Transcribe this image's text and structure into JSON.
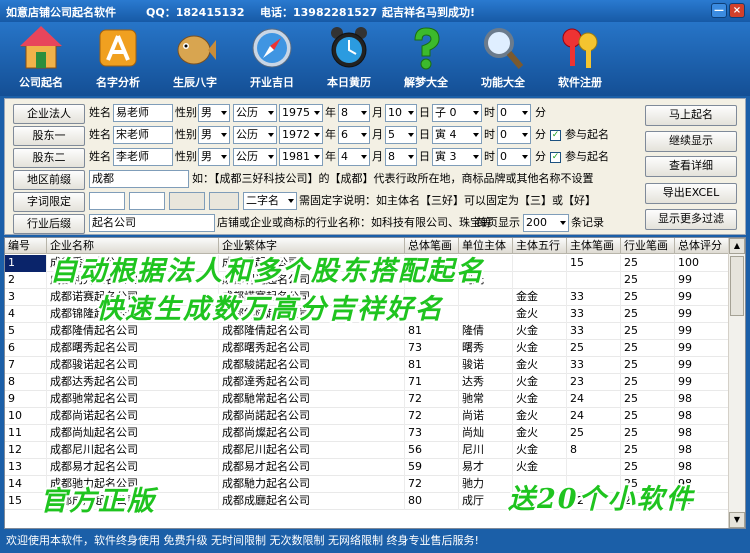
{
  "window": {
    "title": "如意店铺公司起名软件",
    "qq": "QQ：182415132",
    "phone": "电话：13982281527",
    "slogan": "起吉祥名马到成功!",
    "min": "—",
    "close": "×"
  },
  "toolbar": [
    {
      "label": "公司起名",
      "icon": "house-icon"
    },
    {
      "label": "名字分析",
      "icon": "tools-icon"
    },
    {
      "label": "生辰八字",
      "icon": "fish-icon"
    },
    {
      "label": "开业吉日",
      "icon": "compass-icon"
    },
    {
      "label": "本日黄历",
      "icon": "alarm-clock-icon"
    },
    {
      "label": "解梦大全",
      "icon": "question-icon"
    },
    {
      "label": "功能大全",
      "icon": "magnifier-icon"
    },
    {
      "label": "软件注册",
      "icon": "keys-icon"
    }
  ],
  "form": {
    "persons": [
      {
        "role": "企业法人",
        "name_label": "姓名",
        "name": "易老师",
        "sex_label": "性别",
        "sex": "男",
        "cal": "公历",
        "year": "1975",
        "year_u": "年",
        "month": "8",
        "month_u": "月",
        "day": "10",
        "day_u": "日",
        "hour_gz": "子 0",
        "hour_u": "时",
        "minute": "0",
        "minute_u": "分",
        "check": "",
        "check_label": ""
      },
      {
        "role": "股东一",
        "name_label": "姓名",
        "name": "宋老师",
        "sex_label": "性别",
        "sex": "男",
        "cal": "公历",
        "year": "1972",
        "year_u": "年",
        "month": "6",
        "month_u": "月",
        "day": "5",
        "day_u": "日",
        "hour_gz": "寅 4",
        "hour_u": "时",
        "minute": "0",
        "minute_u": "分",
        "check": "✓",
        "check_label": "参与起名"
      },
      {
        "role": "股东二",
        "name_label": "姓名",
        "name": "李老师",
        "sex_label": "性别",
        "sex": "男",
        "cal": "公历",
        "year": "1981",
        "year_u": "年",
        "month": "4",
        "month_u": "月",
        "day": "8",
        "day_u": "日",
        "hour_gz": "寅 3",
        "hour_u": "时",
        "minute": "0",
        "minute_u": "分",
        "check": "✓",
        "check_label": "参与起名"
      }
    ],
    "region_btn": "地区前缀",
    "region_value": "成都",
    "region_hint": "如：【成都三好科技公司】的【成都】代表行政所在地，商标品牌或其他名称不设置",
    "word_btn": "字词限定",
    "word_select": "二字名",
    "word_hint": "需固定字说明：如主体名【三好】可以固定为【三】或【好】",
    "industry_btn": "行业后缀",
    "industry_value": "起名公司",
    "industry_hint": "店铺或企业或商标的行业名称：如科技有限公司、珠宝等",
    "per_page_label": "每页显示",
    "per_page": "200",
    "per_page_unit": "条记录",
    "right_buttons": [
      "马上起名",
      "继续显示",
      "查看详细",
      "导出EXCEL",
      "显示更多过滤"
    ]
  },
  "table": {
    "headers": [
      "编号",
      "企业名称",
      "企业繁体字",
      "总体笔画",
      "单位主体",
      "主体五行",
      "主体笔画",
      "行业笔画",
      "总体评分"
    ],
    "rows": [
      [
        "1",
        "成都秀起名公司",
        "成都秀起名公司",
        "",
        "",
        "",
        "15",
        "25",
        "100"
      ],
      [
        "2",
        "成都利光起名公司",
        "成都利光起名公司",
        "",
        "利光",
        "",
        "",
        "25",
        "99"
      ],
      [
        "3",
        "成都诺赛起名公司",
        "成都諾賽起名公司",
        "",
        "",
        "金金",
        "33",
        "25",
        "99"
      ],
      [
        "4",
        "成都锦隆起名公司",
        "成都錦隆起名公司",
        "",
        "",
        "金火",
        "33",
        "25",
        "99"
      ],
      [
        "5",
        "成都隆倩起名公司",
        "成都隆倩起名公司",
        "81",
        "隆倩",
        "火金",
        "33",
        "25",
        "99"
      ],
      [
        "6",
        "成都曙秀起名公司",
        "成都曙秀起名公司",
        "73",
        "曙秀",
        "火金",
        "25",
        "25",
        "99"
      ],
      [
        "7",
        "成都骏诺起名公司",
        "成都駿諾起名公司",
        "81",
        "骏诺",
        "金火",
        "33",
        "25",
        "99"
      ],
      [
        "8",
        "成都达秀起名公司",
        "成都達秀起名公司",
        "71",
        "达秀",
        "火金",
        "23",
        "25",
        "99"
      ],
      [
        "9",
        "成都驰常起名公司",
        "成都馳常起名公司",
        "72",
        "驰常",
        "火金",
        "24",
        "25",
        "98"
      ],
      [
        "10",
        "成都尚诺起名公司",
        "成都尚諾起名公司",
        "72",
        "尚诺",
        "金火",
        "24",
        "25",
        "98"
      ],
      [
        "11",
        "成都尚灿起名公司",
        "成都尚燦起名公司",
        "73",
        "尚灿",
        "金火",
        "25",
        "25",
        "98"
      ],
      [
        "12",
        "成都尼川起名公司",
        "成都尼川起名公司",
        "56",
        "尼川",
        "火金",
        "8",
        "25",
        "98"
      ],
      [
        "13",
        "成都易才起名公司",
        "成都易才起名公司",
        "59",
        "易才",
        "火金",
        "",
        "25",
        "98"
      ],
      [
        "14",
        "成都驰力起名公司",
        "成都馳力起名公司",
        "72",
        "驰力",
        "",
        "",
        "25",
        "98"
      ],
      [
        "15",
        "成都成厅起名公司",
        "成都成廳起名公司",
        "80",
        "成厅",
        "金火",
        "32",
        "25",
        "98"
      ]
    ]
  },
  "overlays": {
    "line1": "自动根据法人和多个股东搭配起名",
    "line2": "快速生成数万高分吉祥好名",
    "badge_left": "官方正版",
    "badge_right": "送20个小软件"
  },
  "status": "欢迎使用本软件，软件终身使用  免费升级  无时间限制  无次数限制  无网络限制  终身专业售后服务!"
}
